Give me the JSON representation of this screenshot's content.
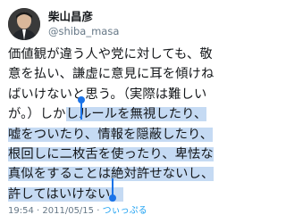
{
  "user": {
    "name": "柴山昌彦",
    "handle": "@shiba_masa"
  },
  "tweet": {
    "lines": [
      "価値観が違う人や党に対しても、敬",
      "意を払い、謙虚に意見に耳を傾けね",
      "ばいけないと思う。（実際は難しい",
      "が。）しかしルールを無視したり、",
      "嘘をついたり、情報を隠蔽したり、",
      "根回しに二枚舌を使ったり、卑怯な",
      "真似をすることは絶対許せないし、",
      "許してはいけない。"
    ],
    "line4_plain": "が。）しか",
    "line4_selected": "しルールを無視したり、"
  },
  "meta": {
    "time": "19:54",
    "separator": "·",
    "date": "2011/05/15",
    "via": "つぃっぷる"
  },
  "colors": {
    "selection": "#c5daf3",
    "cursor": "#1a73e8",
    "handle": "#657786",
    "link": "#1da1f2"
  },
  "icons": [
    "avatar-photo",
    "selection-start-handle",
    "selection-end-handle"
  ]
}
